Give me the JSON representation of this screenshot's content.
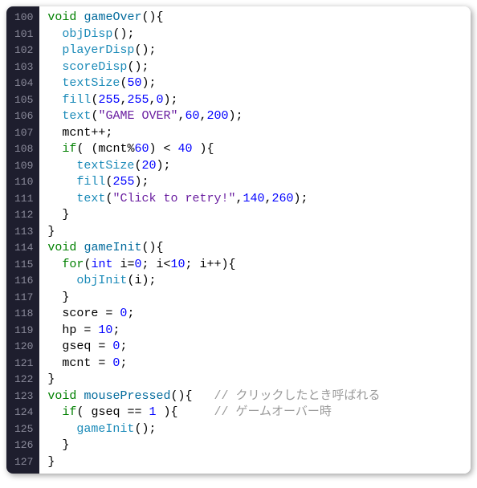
{
  "startLine": 100,
  "lines": [
    [
      [
        "kw",
        "void"
      ],
      [
        "plain",
        " "
      ],
      [
        "fn",
        "gameOver"
      ],
      [
        "plain",
        "(){"
      ]
    ],
    [
      [
        "plain",
        "  "
      ],
      [
        "fn2",
        "objDisp"
      ],
      [
        "plain",
        "();"
      ]
    ],
    [
      [
        "plain",
        "  "
      ],
      [
        "fn2",
        "playerDisp"
      ],
      [
        "plain",
        "();"
      ]
    ],
    [
      [
        "plain",
        "  "
      ],
      [
        "fn2",
        "scoreDisp"
      ],
      [
        "plain",
        "();"
      ]
    ],
    [
      [
        "plain",
        "  "
      ],
      [
        "fn2",
        "textSize"
      ],
      [
        "plain",
        "("
      ],
      [
        "num",
        "50"
      ],
      [
        "plain",
        ");"
      ]
    ],
    [
      [
        "plain",
        "  "
      ],
      [
        "fn2",
        "fill"
      ],
      [
        "plain",
        "("
      ],
      [
        "num",
        "255"
      ],
      [
        "plain",
        ","
      ],
      [
        "num",
        "255"
      ],
      [
        "plain",
        ","
      ],
      [
        "num",
        "0"
      ],
      [
        "plain",
        ");"
      ]
    ],
    [
      [
        "plain",
        "  "
      ],
      [
        "fn2",
        "text"
      ],
      [
        "plain",
        "("
      ],
      [
        "str",
        "\"GAME OVER\""
      ],
      [
        "plain",
        ","
      ],
      [
        "num",
        "60"
      ],
      [
        "plain",
        ","
      ],
      [
        "num",
        "200"
      ],
      [
        "plain",
        ");"
      ]
    ],
    [
      [
        "plain",
        "  mcnt++;"
      ]
    ],
    [
      [
        "plain",
        "  "
      ],
      [
        "kw",
        "if"
      ],
      [
        "plain",
        "( (mcnt%"
      ],
      [
        "num",
        "60"
      ],
      [
        "plain",
        ") < "
      ],
      [
        "num",
        "40"
      ],
      [
        "plain",
        " ){"
      ]
    ],
    [
      [
        "plain",
        "    "
      ],
      [
        "fn2",
        "textSize"
      ],
      [
        "plain",
        "("
      ],
      [
        "num",
        "20"
      ],
      [
        "plain",
        ");"
      ]
    ],
    [
      [
        "plain",
        "    "
      ],
      [
        "fn2",
        "fill"
      ],
      [
        "plain",
        "("
      ],
      [
        "num",
        "255"
      ],
      [
        "plain",
        ");"
      ]
    ],
    [
      [
        "plain",
        "    "
      ],
      [
        "fn2",
        "text"
      ],
      [
        "plain",
        "("
      ],
      [
        "str",
        "\"Click to retry!\""
      ],
      [
        "plain",
        ","
      ],
      [
        "num",
        "140"
      ],
      [
        "plain",
        ","
      ],
      [
        "num",
        "260"
      ],
      [
        "plain",
        ");"
      ]
    ],
    [
      [
        "plain",
        "  }"
      ]
    ],
    [
      [
        "plain",
        "}"
      ]
    ],
    [
      [
        "kw",
        "void"
      ],
      [
        "plain",
        " "
      ],
      [
        "fn",
        "gameInit"
      ],
      [
        "plain",
        "(){"
      ]
    ],
    [
      [
        "plain",
        "  "
      ],
      [
        "kw",
        "for"
      ],
      [
        "plain",
        "("
      ],
      [
        "type",
        "int"
      ],
      [
        "plain",
        " i="
      ],
      [
        "num",
        "0"
      ],
      [
        "plain",
        "; i<"
      ],
      [
        "num",
        "10"
      ],
      [
        "plain",
        "; i++){"
      ]
    ],
    [
      [
        "plain",
        "    "
      ],
      [
        "fn2",
        "objInit"
      ],
      [
        "plain",
        "(i);"
      ]
    ],
    [
      [
        "plain",
        "  }"
      ]
    ],
    [
      [
        "plain",
        "  score = "
      ],
      [
        "num",
        "0"
      ],
      [
        "plain",
        ";"
      ]
    ],
    [
      [
        "plain",
        "  hp = "
      ],
      [
        "num",
        "10"
      ],
      [
        "plain",
        ";"
      ]
    ],
    [
      [
        "plain",
        "  gseq = "
      ],
      [
        "num",
        "0"
      ],
      [
        "plain",
        ";"
      ]
    ],
    [
      [
        "plain",
        "  mcnt = "
      ],
      [
        "num",
        "0"
      ],
      [
        "plain",
        ";"
      ]
    ],
    [
      [
        "plain",
        "}"
      ]
    ],
    [
      [
        "kw",
        "void"
      ],
      [
        "plain",
        " "
      ],
      [
        "fn",
        "mousePressed"
      ],
      [
        "plain",
        "(){   "
      ],
      [
        "cmt",
        "// クリックしたとき呼ばれる"
      ]
    ],
    [
      [
        "plain",
        "  "
      ],
      [
        "kw",
        "if"
      ],
      [
        "plain",
        "( gseq == "
      ],
      [
        "num",
        "1"
      ],
      [
        "plain",
        " ){     "
      ],
      [
        "cmt",
        "// ゲームオーバー時"
      ]
    ],
    [
      [
        "plain",
        "    "
      ],
      [
        "fn2",
        "gameInit"
      ],
      [
        "plain",
        "();"
      ]
    ],
    [
      [
        "plain",
        "  }"
      ]
    ],
    [
      [
        "plain",
        "}"
      ]
    ]
  ]
}
